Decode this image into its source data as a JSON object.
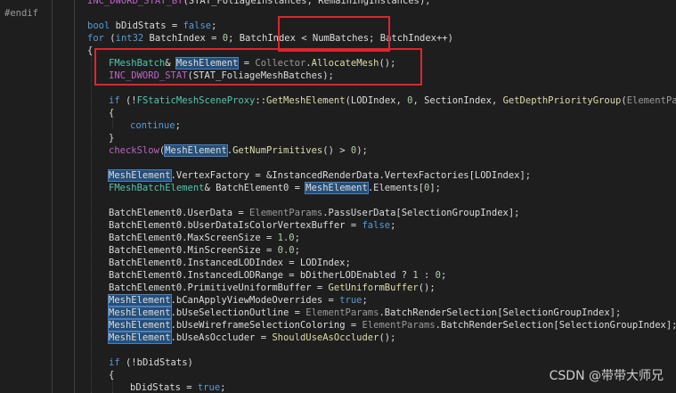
{
  "editor": {
    "lines": [
      {
        "tokens": [
          {
            "t": "INC_DWORD_STAT_BY",
            "c": "mac"
          },
          {
            "t": "(STAT_FoliageInstances, RemainingInstances);",
            "c": "pl"
          }
        ]
      },
      {
        "tokens": [
          {
            "t": "#endif",
            "c": "pp"
          }
        ]
      },
      {
        "tokens": [
          {
            "t": "bool",
            "c": "kw"
          },
          {
            "t": " bDidStats = ",
            "c": "pl"
          },
          {
            "t": "false",
            "c": "kw"
          },
          {
            "t": ";",
            "c": "pl"
          }
        ]
      },
      {
        "tokens": [
          {
            "t": "for",
            "c": "kw"
          },
          {
            "t": " (",
            "c": "pl"
          },
          {
            "t": "int32",
            "c": "kw"
          },
          {
            "t": " BatchIndex = ",
            "c": "pl"
          },
          {
            "t": "0",
            "c": "num"
          },
          {
            "t": "; BatchIndex < NumBatches; BatchIndex++)",
            "c": "pl"
          }
        ]
      },
      {
        "tokens": [
          {
            "t": "{",
            "c": "pl"
          }
        ]
      },
      {
        "tokens": [
          {
            "t": "FMeshBatch",
            "c": "ty"
          },
          {
            "t": "& ",
            "c": "pl"
          },
          {
            "t": "MeshElement",
            "c": "pl",
            "h": true
          },
          {
            "t": " = ",
            "c": "pl"
          },
          {
            "t": "Collector",
            "c": "par"
          },
          {
            "t": ".",
            "c": "pl"
          },
          {
            "t": "AllocateMesh",
            "c": "fn"
          },
          {
            "t": "();",
            "c": "pl"
          }
        ]
      },
      {
        "tokens": [
          {
            "t": "INC_DWORD_STAT",
            "c": "mac"
          },
          {
            "t": "(STAT_FoliageMeshBatches);",
            "c": "pl"
          }
        ]
      },
      {
        "tokens": []
      },
      {
        "tokens": [
          {
            "t": "if",
            "c": "kw"
          },
          {
            "t": " (!",
            "c": "pl"
          },
          {
            "t": "FStaticMeshSceneProxy",
            "c": "ty"
          },
          {
            "t": "::",
            "c": "pl"
          },
          {
            "t": "GetMeshElement",
            "c": "fn"
          },
          {
            "t": "(LODIndex, ",
            "c": "pl"
          },
          {
            "t": "0",
            "c": "num"
          },
          {
            "t": ", SectionIndex, ",
            "c": "pl"
          },
          {
            "t": "GetDepthPriorityGroup",
            "c": "fn"
          },
          {
            "t": "(",
            "c": "pl"
          },
          {
            "t": "ElementParams",
            "c": "par"
          },
          {
            "t": ".Vie",
            "c": "pl"
          }
        ]
      },
      {
        "tokens": [
          {
            "t": "{",
            "c": "pl"
          }
        ]
      },
      {
        "tokens": [
          {
            "t": "continue",
            "c": "kw"
          },
          {
            "t": ";",
            "c": "pl"
          }
        ]
      },
      {
        "tokens": [
          {
            "t": "}",
            "c": "pl"
          }
        ]
      },
      {
        "tokens": [
          {
            "t": "checkSlow",
            "c": "mac"
          },
          {
            "t": "(",
            "c": "pl"
          },
          {
            "t": "MeshElement",
            "c": "pl",
            "h": true
          },
          {
            "t": ".",
            "c": "pl"
          },
          {
            "t": "GetNumPrimitives",
            "c": "fn"
          },
          {
            "t": "() > ",
            "c": "pl"
          },
          {
            "t": "0",
            "c": "num"
          },
          {
            "t": ");",
            "c": "pl"
          }
        ]
      },
      {
        "tokens": []
      },
      {
        "tokens": [
          {
            "t": "MeshElement",
            "c": "pl",
            "h": true
          },
          {
            "t": ".VertexFactory = &InstancedRenderData.VertexFactories[LODIndex];",
            "c": "pl"
          }
        ]
      },
      {
        "tokens": [
          {
            "t": "FMeshBatchElement",
            "c": "ty"
          },
          {
            "t": "& BatchElement0 = ",
            "c": "pl"
          },
          {
            "t": "MeshElement",
            "c": "pl",
            "h": true
          },
          {
            "t": ".Elements[",
            "c": "pl"
          },
          {
            "t": "0",
            "c": "num"
          },
          {
            "t": "];",
            "c": "pl"
          }
        ]
      },
      {
        "tokens": []
      },
      {
        "tokens": [
          {
            "t": "BatchElement0.UserData = ",
            "c": "pl"
          },
          {
            "t": "ElementParams",
            "c": "par"
          },
          {
            "t": ".PassUserData[SelectionGroupIndex];",
            "c": "pl"
          }
        ]
      },
      {
        "tokens": [
          {
            "t": "BatchElement0.bUserDataIsColorVertexBuffer = ",
            "c": "pl"
          },
          {
            "t": "false",
            "c": "kw"
          },
          {
            "t": ";",
            "c": "pl"
          }
        ]
      },
      {
        "tokens": [
          {
            "t": "BatchElement0.MaxScreenSize = ",
            "c": "pl"
          },
          {
            "t": "1.0",
            "c": "num"
          },
          {
            "t": ";",
            "c": "pl"
          }
        ]
      },
      {
        "tokens": [
          {
            "t": "BatchElement0.MinScreenSize = ",
            "c": "pl"
          },
          {
            "t": "0.0",
            "c": "num"
          },
          {
            "t": ";",
            "c": "pl"
          }
        ]
      },
      {
        "tokens": [
          {
            "t": "BatchElement0.InstancedLODIndex = LODIndex;",
            "c": "pl"
          }
        ]
      },
      {
        "tokens": [
          {
            "t": "BatchElement0.InstancedLODRange = bDitherLODEnabled ? ",
            "c": "pl"
          },
          {
            "t": "1",
            "c": "num"
          },
          {
            "t": " : ",
            "c": "pl"
          },
          {
            "t": "0",
            "c": "num"
          },
          {
            "t": ";",
            "c": "pl"
          }
        ]
      },
      {
        "tokens": [
          {
            "t": "BatchElement0.PrimitiveUniformBuffer = ",
            "c": "pl"
          },
          {
            "t": "GetUniformBuffer",
            "c": "fn"
          },
          {
            "t": "();",
            "c": "pl"
          }
        ]
      },
      {
        "tokens": [
          {
            "t": "MeshElement",
            "c": "pl",
            "h": true
          },
          {
            "t": ".bCanApplyViewModeOverrides = ",
            "c": "pl"
          },
          {
            "t": "true",
            "c": "kw"
          },
          {
            "t": ";",
            "c": "pl"
          }
        ]
      },
      {
        "tokens": [
          {
            "t": "MeshElement",
            "c": "pl",
            "h": true
          },
          {
            "t": ".bUseSelectionOutline = ",
            "c": "pl"
          },
          {
            "t": "ElementParams",
            "c": "par"
          },
          {
            "t": ".BatchRenderSelection[SelectionGroupIndex];",
            "c": "pl"
          }
        ]
      },
      {
        "tokens": [
          {
            "t": "MeshElement",
            "c": "pl",
            "h": true
          },
          {
            "t": ".bUseWireframeSelectionColoring = ",
            "c": "pl"
          },
          {
            "t": "ElementParams",
            "c": "par"
          },
          {
            "t": ".BatchRenderSelection[SelectionGroupIndex];",
            "c": "pl"
          }
        ]
      },
      {
        "tokens": [
          {
            "t": "MeshElement",
            "c": "pl",
            "h": true
          },
          {
            "t": ".bUseAsOccluder = ",
            "c": "pl"
          },
          {
            "t": "ShouldUseAsOccluder",
            "c": "fn"
          },
          {
            "t": "();",
            "c": "pl"
          }
        ]
      },
      {
        "tokens": []
      },
      {
        "tokens": [
          {
            "t": "if",
            "c": "kw"
          },
          {
            "t": " (!bDidStats)",
            "c": "pl"
          }
        ]
      },
      {
        "tokens": [
          {
            "t": "{",
            "c": "pl"
          }
        ]
      },
      {
        "tokens": [
          {
            "t": "bDidStats = ",
            "c": "pl"
          },
          {
            "t": "true",
            "c": "kw"
          },
          {
            "t": ";",
            "c": "pl"
          }
        ]
      }
    ]
  },
  "watermark": "CSDN @带带大师兄"
}
